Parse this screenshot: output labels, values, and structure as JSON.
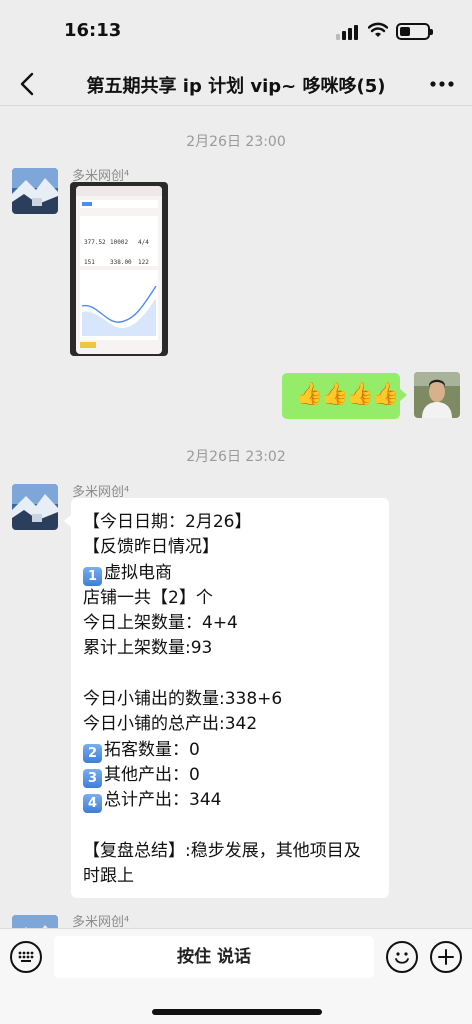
{
  "status_bar": {
    "time": "16:13"
  },
  "nav": {
    "title": "第五期共享 ip 计划 vip~ 哆咪哆(5)"
  },
  "timestamps": [
    "2月26日 23:00",
    "2月26日 23:02"
  ],
  "sender_name": "多米网创⁴",
  "photo_message": {
    "values_row1": [
      "377.52",
      "10002",
      "4/4"
    ],
    "values_row2": [
      "151",
      "338.00",
      "122"
    ]
  },
  "my_message": {
    "text": "👍👍👍👍"
  },
  "report": {
    "lines": [
      "【今日日期：2月26】",
      "【反馈昨日情况】",
      "虚拟电商",
      "店铺一共【2】个",
      "今日上架数量：4+4",
      "累计上架数量:93",
      "",
      "今日小铺出的数量:338+6",
      "今日小铺的总产出:342",
      "拓客数量：0",
      "其他产出：0",
      "总计产出：344",
      "",
      "【复盘总结】:稳步发展，其他项目及",
      "时跟上"
    ],
    "keycaps": [
      "1",
      "2",
      "3",
      "4"
    ]
  },
  "input_bar": {
    "hold_to_talk": "按住 说话"
  }
}
